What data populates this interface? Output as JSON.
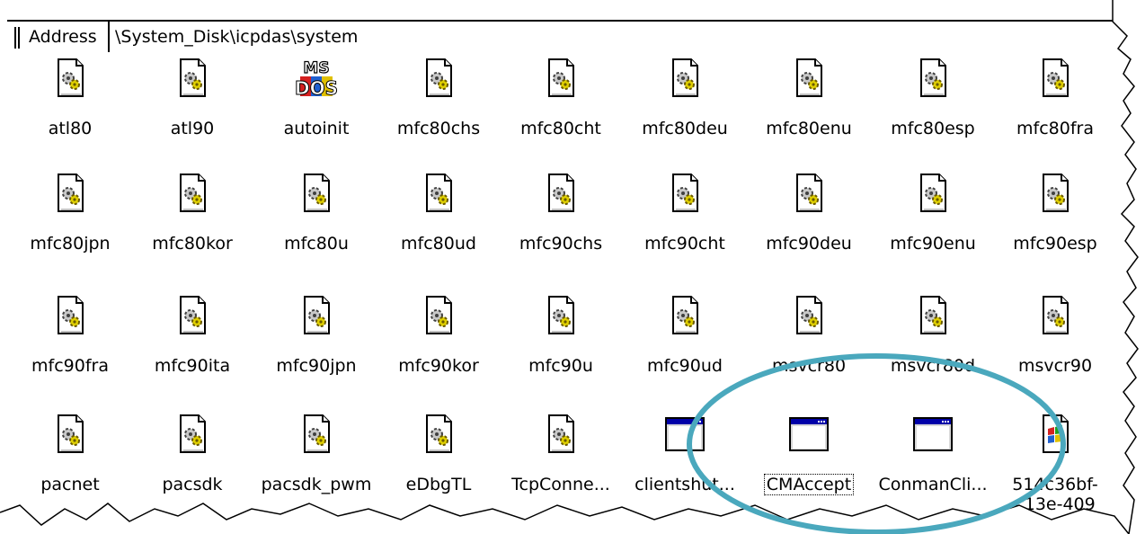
{
  "addressbar": {
    "label": "Address",
    "path": "\\System_Disk\\icpdas\\system"
  },
  "files": [
    {
      "name": "atl80",
      "icon": "dll-file-icon"
    },
    {
      "name": "atl90",
      "icon": "dll-file-icon"
    },
    {
      "name": "autoinit",
      "icon": "msdos-icon"
    },
    {
      "name": "mfc80chs",
      "icon": "dll-file-icon"
    },
    {
      "name": "mfc80cht",
      "icon": "dll-file-icon"
    },
    {
      "name": "mfc80deu",
      "icon": "dll-file-icon"
    },
    {
      "name": "mfc80enu",
      "icon": "dll-file-icon"
    },
    {
      "name": "mfc80esp",
      "icon": "dll-file-icon"
    },
    {
      "name": "mfc80fra",
      "icon": "dll-file-icon"
    },
    {
      "name": "mfc80jpn",
      "icon": "dll-file-icon"
    },
    {
      "name": "mfc80kor",
      "icon": "dll-file-icon"
    },
    {
      "name": "mfc80u",
      "icon": "dll-file-icon"
    },
    {
      "name": "mfc80ud",
      "icon": "dll-file-icon"
    },
    {
      "name": "mfc90chs",
      "icon": "dll-file-icon"
    },
    {
      "name": "mfc90cht",
      "icon": "dll-file-icon"
    },
    {
      "name": "mfc90deu",
      "icon": "dll-file-icon"
    },
    {
      "name": "mfc90enu",
      "icon": "dll-file-icon"
    },
    {
      "name": "mfc90esp",
      "icon": "dll-file-icon"
    },
    {
      "name": "mfc90fra",
      "icon": "dll-file-icon"
    },
    {
      "name": "mfc90ita",
      "icon": "dll-file-icon"
    },
    {
      "name": "mfc90jpn",
      "icon": "dll-file-icon"
    },
    {
      "name": "mfc90kor",
      "icon": "dll-file-icon"
    },
    {
      "name": "mfc90u",
      "icon": "dll-file-icon"
    },
    {
      "name": "mfc90ud",
      "icon": "dll-file-icon"
    },
    {
      "name": "msvcr80",
      "icon": "dll-file-icon"
    },
    {
      "name": "msvcr80d",
      "icon": "dll-file-icon"
    },
    {
      "name": "msvcr90",
      "icon": "dll-file-icon"
    },
    {
      "name": "pacnet",
      "icon": "dll-file-icon"
    },
    {
      "name": "pacsdk",
      "icon": "dll-file-icon"
    },
    {
      "name": "pacsdk_pwm",
      "icon": "dll-file-icon"
    },
    {
      "name": "eDbgTL",
      "icon": "dll-file-icon"
    },
    {
      "name": "TcpConne...",
      "icon": "dll-file-icon"
    },
    {
      "name": "clientshut...",
      "icon": "application-window-icon"
    },
    {
      "name": "CMAccept",
      "icon": "application-window-icon",
      "selected": true
    },
    {
      "name": "ConmanCli...",
      "icon": "application-window-icon"
    },
    {
      "name": "514c36bf-c13e-409",
      "icon": "windows-logo-file-icon"
    }
  ],
  "highlight": {
    "color": "#4aa8bd",
    "shape": "ellipse",
    "label": ""
  }
}
